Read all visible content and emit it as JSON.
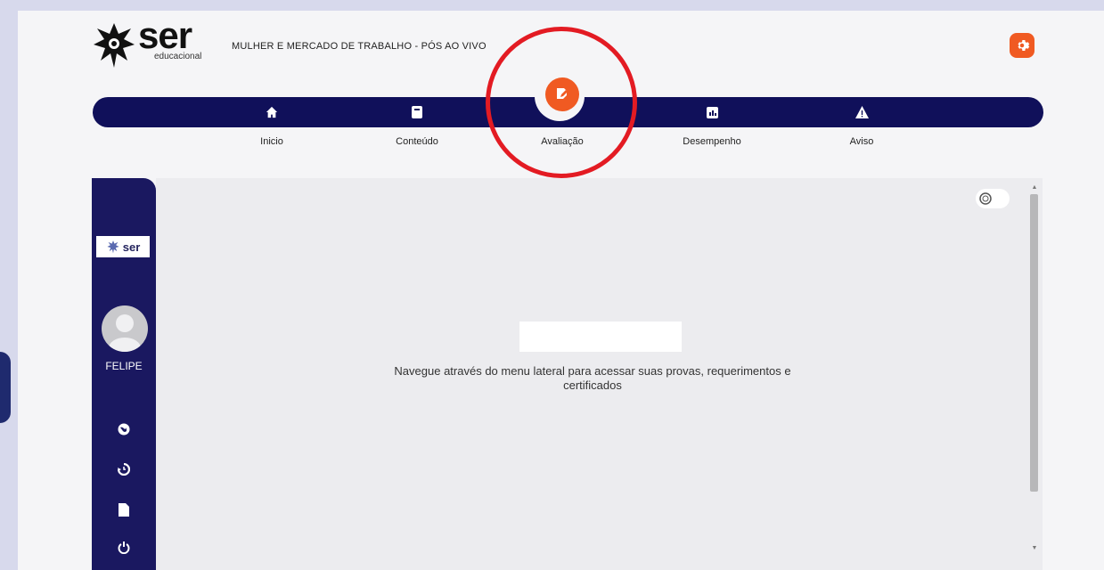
{
  "header": {
    "brand": "ser",
    "brand_sub": "educacional",
    "course_title": "MULHER E MERCADO DE TRABALHO - PÓS AO VIVO"
  },
  "nav": {
    "items": [
      {
        "label": "Inicio",
        "icon": "home-icon"
      },
      {
        "label": "Conteúdo",
        "icon": "book-icon"
      },
      {
        "label": "Avaliação",
        "icon": "edit-icon",
        "active": true
      },
      {
        "label": "Desempenho",
        "icon": "chart-icon"
      },
      {
        "label": "Aviso",
        "icon": "warning-icon"
      }
    ]
  },
  "sidebar": {
    "logo_text": "ser",
    "user_name": "FELIPE",
    "icons": [
      "globe-icon",
      "history-icon",
      "document-icon",
      "power-icon"
    ]
  },
  "main": {
    "message": "Navegue através do menu lateral para acessar suas provas, requerimentos e certificados"
  },
  "colors": {
    "accent": "#f05a22",
    "navbar": "#10105a",
    "sidebar": "#1a1860",
    "highlight_ring": "#e31b23"
  }
}
